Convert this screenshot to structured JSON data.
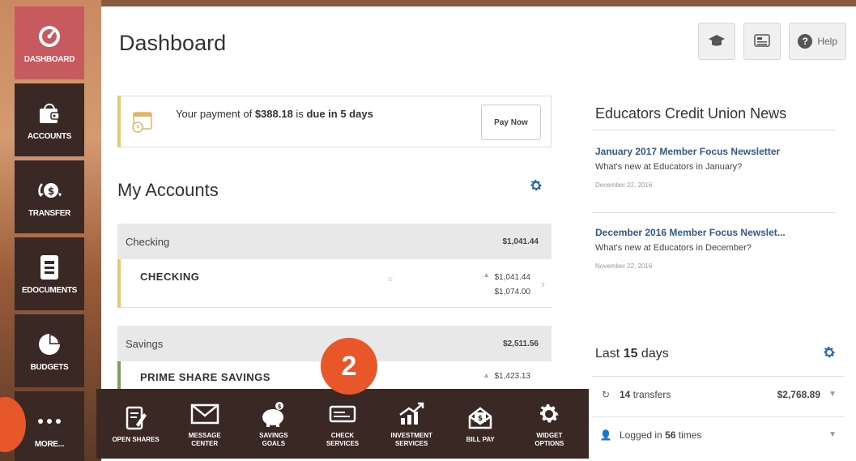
{
  "sidebar": {
    "items": [
      {
        "label": "DASHBOARD",
        "icon": "dashboard-icon"
      },
      {
        "label": "ACCOUNTS",
        "icon": "wallet-icon"
      },
      {
        "label": "TRANSFER",
        "icon": "transfer-icon"
      },
      {
        "label": "EDOCUMENTS",
        "icon": "document-icon"
      },
      {
        "label": "BUDGETS",
        "icon": "pie-chart-icon"
      },
      {
        "label": "MORE...",
        "icon": "more-dots-icon"
      }
    ]
  },
  "header": {
    "title": "Dashboard",
    "help_label": "Help"
  },
  "payment_alert": {
    "prefix": "Your payment of ",
    "amount": "$388.18",
    "middle": " is ",
    "due": "due in 5 days",
    "button": "Pay Now"
  },
  "accounts": {
    "title": "My Accounts",
    "groups": [
      {
        "name": "Checking",
        "total": "$1,041.44"
      },
      {
        "name": "Savings",
        "total": "$2,511.56"
      }
    ],
    "rows": [
      {
        "name": "CHECKING",
        "balance": "$1,041.44",
        "available": "$1,074.00"
      },
      {
        "name": "PRIME SHARE SAVINGS",
        "balance": "$1,423.13"
      }
    ]
  },
  "news": {
    "title": "Educators Credit Union News",
    "items": [
      {
        "headline": "January 2017 Member Focus Newsletter",
        "desc": "What's new at Educators in January?",
        "date": "December 22, 2016"
      },
      {
        "headline": "December 2016 Member Focus Newslet...",
        "desc": "What's new at Educators in December?",
        "date": "November 22, 2016"
      }
    ]
  },
  "last_days": {
    "prefix": "Last ",
    "days": "15",
    "suffix": " days",
    "transfers_count": "14",
    "transfers_label": " transfers",
    "transfers_amount": "$2,768.89",
    "logged_prefix": "Logged in ",
    "logged_count": "56",
    "logged_suffix": " times"
  },
  "flyout": {
    "items": [
      {
        "label": "OPEN SHARES",
        "icon": "edit-document-icon"
      },
      {
        "label": "MESSAGE\nCENTER",
        "icon": "envelope-icon"
      },
      {
        "label": "SAVINGS\nGOALS",
        "icon": "piggy-bank-icon"
      },
      {
        "label": "CHECK\nSERVICES",
        "icon": "check-card-icon"
      },
      {
        "label": "INVESTMENT\nSERVICES",
        "icon": "growth-chart-icon"
      },
      {
        "label": "BILL PAY",
        "icon": "bill-envelope-icon"
      },
      {
        "label": "WIDGET\nOPTIONS",
        "icon": "gear-icon"
      }
    ]
  },
  "callout_badge": "2",
  "colors": {
    "sidebar_bg": "#3a2824",
    "active": "#c65a5e",
    "link": "#2d5b8e",
    "accent_orange": "#e8572a",
    "gear_blue": "#2d6aa8"
  }
}
